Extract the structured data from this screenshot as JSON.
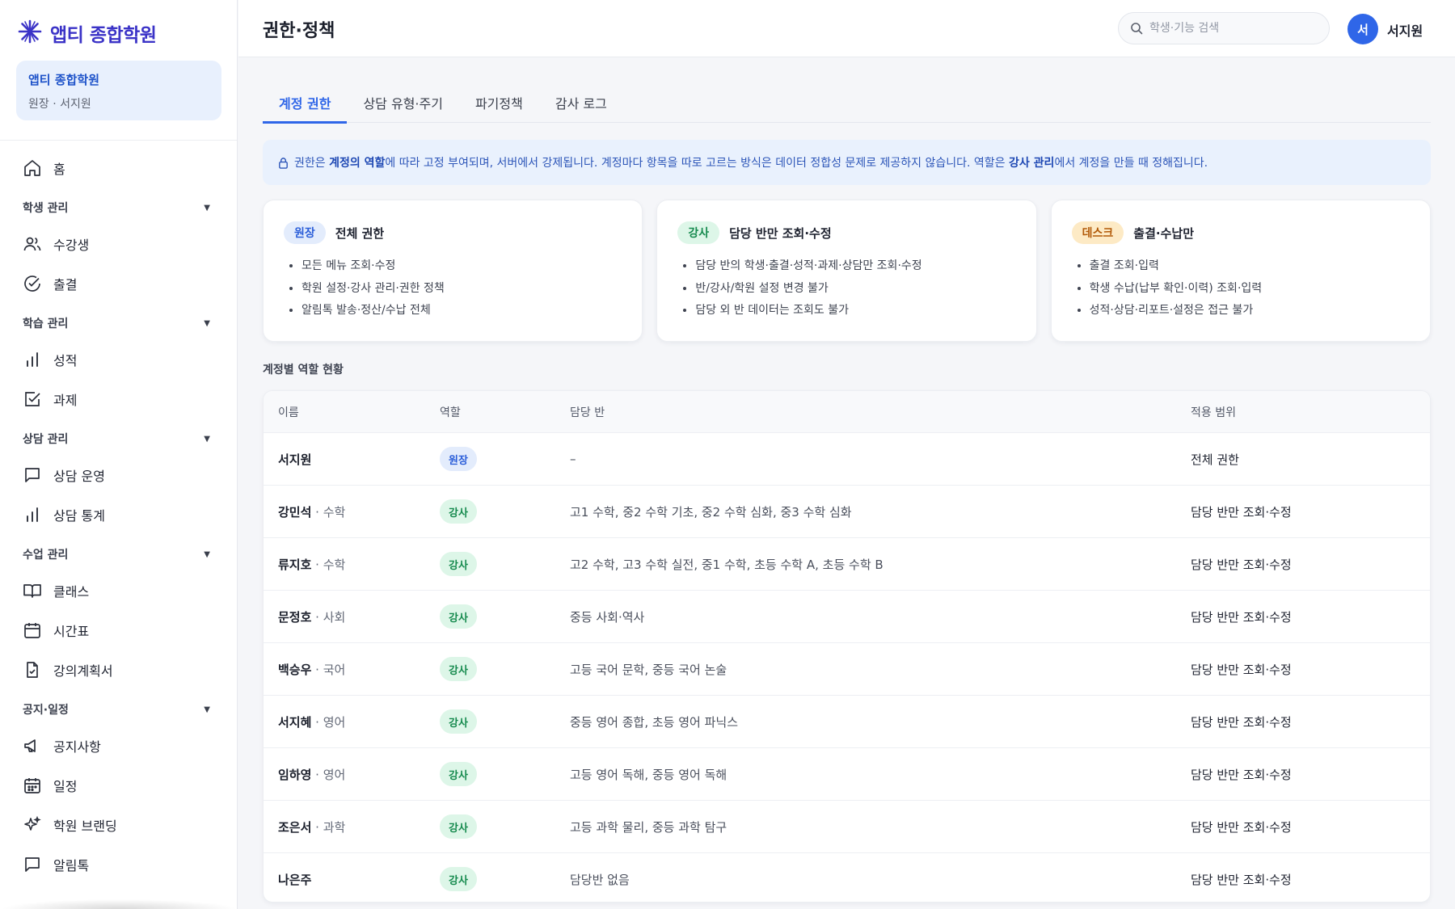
{
  "app": {
    "brand": "앱티 종합학원",
    "academy_name": "앱티 종합학원",
    "academy_sub": "원장 · 서지원"
  },
  "sidebar": {
    "home": "홈",
    "sections": [
      {
        "label": "학생 관리",
        "items": [
          "수강생",
          "출결"
        ]
      },
      {
        "label": "학습 관리",
        "items": [
          "성적",
          "과제"
        ]
      },
      {
        "label": "상담 관리",
        "items": [
          "상담 운영",
          "상담 통계"
        ]
      },
      {
        "label": "수업 관리",
        "items": [
          "클래스",
          "시간표",
          "강의계획서"
        ]
      },
      {
        "label": "공지·일정",
        "items": [
          "공지사항",
          "일정",
          "학원 브랜딩",
          "알림톡"
        ]
      }
    ]
  },
  "header": {
    "title": "권한·정책",
    "search_placeholder": "학생·기능 검색",
    "avatar_initial": "서",
    "user_name": "서지원"
  },
  "tabs": [
    "계정 권한",
    "상담 유형·주기",
    "파기정책",
    "감사 로그"
  ],
  "notice": {
    "p1": "권한은 ",
    "b1": "계정의 역할",
    "p2": "에 따라 고정 부여되며, 서버에서 강제됩니다. 계정마다 항목을 따로 고르는 방식은 데이터 정합성 문제로 제공하지 않습니다. 역할은 ",
    "b2": "강사 관리",
    "p3": "에서 계정을 만들 때 정해집니다."
  },
  "roles": [
    {
      "badge": "원장",
      "title": "전체 권한",
      "items": [
        "모든 메뉴 조회·수정",
        "학원 설정·강사 관리·권한 정책",
        "알림톡 발송·정산/수납 전체"
      ]
    },
    {
      "badge": "강사",
      "title": "담당 반만 조회·수정",
      "items": [
        "담당 반의 학생·출결·성적·과제·상담만 조회·수정",
        "반/강사/학원 설정 변경 불가",
        "담당 외 반 데이터는 조회도 불가"
      ]
    },
    {
      "badge": "데스크",
      "title": "출결·수납만",
      "items": [
        "출결 조회·입력",
        "학생 수납(납부 확인·이력) 조회·입력",
        "성적·상담·리포트·설정은 접근 불가"
      ]
    }
  ],
  "accounts": {
    "section_label": "계정별 역할 현황",
    "columns": [
      "이름",
      "역할",
      "담당 반",
      "적용 범위"
    ],
    "rows": [
      {
        "name": "서지원",
        "subject": "",
        "role": "원장",
        "classes": "–",
        "scope": "전체 권한"
      },
      {
        "name": "강민석",
        "subject": " · 수학",
        "role": "강사",
        "classes": "고1 수학, 중2 수학 기초, 중2 수학 심화, 중3 수학 심화",
        "scope": "담당 반만 조회·수정"
      },
      {
        "name": "류지호",
        "subject": " · 수학",
        "role": "강사",
        "classes": "고2 수학, 고3 수학 실전, 중1 수학, 초등 수학 A, 초등 수학 B",
        "scope": "담당 반만 조회·수정"
      },
      {
        "name": "문정호",
        "subject": " · 사회",
        "role": "강사",
        "classes": "중등 사회·역사",
        "scope": "담당 반만 조회·수정"
      },
      {
        "name": "백승우",
        "subject": " · 국어",
        "role": "강사",
        "classes": "고등 국어 문학, 중등 국어 논술",
        "scope": "담당 반만 조회·수정"
      },
      {
        "name": "서지혜",
        "subject": " · 영어",
        "role": "강사",
        "classes": "중등 영어 종합, 초등 영어 파닉스",
        "scope": "담당 반만 조회·수정"
      },
      {
        "name": "임하영",
        "subject": " · 영어",
        "role": "강사",
        "classes": "고등 영어 독해, 중등 영어 독해",
        "scope": "담당 반만 조회·수정"
      },
      {
        "name": "조은서",
        "subject": " · 과학",
        "role": "강사",
        "classes": "고등 과학 물리, 중등 과학 탐구",
        "scope": "담당 반만 조회·수정"
      },
      {
        "name": "나은주",
        "subject": "",
        "role": "강사",
        "classes": "담당반 없음",
        "scope": "담당 반만 조회·수정"
      }
    ]
  },
  "colors": {
    "accent": "#2f66e8",
    "brand": "#3b33c7",
    "teacher_badge": "#168a4e",
    "desk_badge": "#b25a09"
  }
}
